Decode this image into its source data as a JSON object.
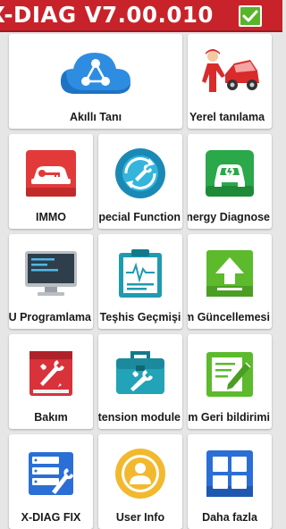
{
  "header": {
    "title": "X-DIAG V7.00.010",
    "colors": {
      "bar": "#c8232a",
      "check": "#58b52b"
    },
    "check_icon": "checkmark-icon"
  },
  "tiles": [
    {
      "label": "Akıllı Tanı",
      "icon": "cloud-network-icon"
    },
    {
      "label": "Yerel tanılama",
      "icon": "mechanic-car-icon"
    },
    {
      "label": "IMMO",
      "icon": "car-key-icon"
    },
    {
      "label": "Special Function",
      "icon": "wrench-refresh-icon"
    },
    {
      "label": "New Energy Diagnose",
      "icon": "electric-car-icon"
    },
    {
      "label": "ECU Programlama",
      "icon": "monitor-icon"
    },
    {
      "label": "Teşhis Geçmişi",
      "icon": "clipboard-chart-icon"
    },
    {
      "label": "Yazılım Güncellemesi",
      "icon": "upload-arrow-icon"
    },
    {
      "label": "Bakım",
      "icon": "tools-book-icon"
    },
    {
      "label": "Extension module",
      "icon": "toolbox-icon"
    },
    {
      "label": "Yazılım Geri bildirimi",
      "icon": "feedback-edit-icon"
    },
    {
      "label": "X-DIAG FIX",
      "icon": "server-wrench-icon"
    },
    {
      "label": "User Info",
      "icon": "user-avatar-icon"
    },
    {
      "label": "Daha fazla",
      "icon": "more-grid-icon"
    }
  ]
}
